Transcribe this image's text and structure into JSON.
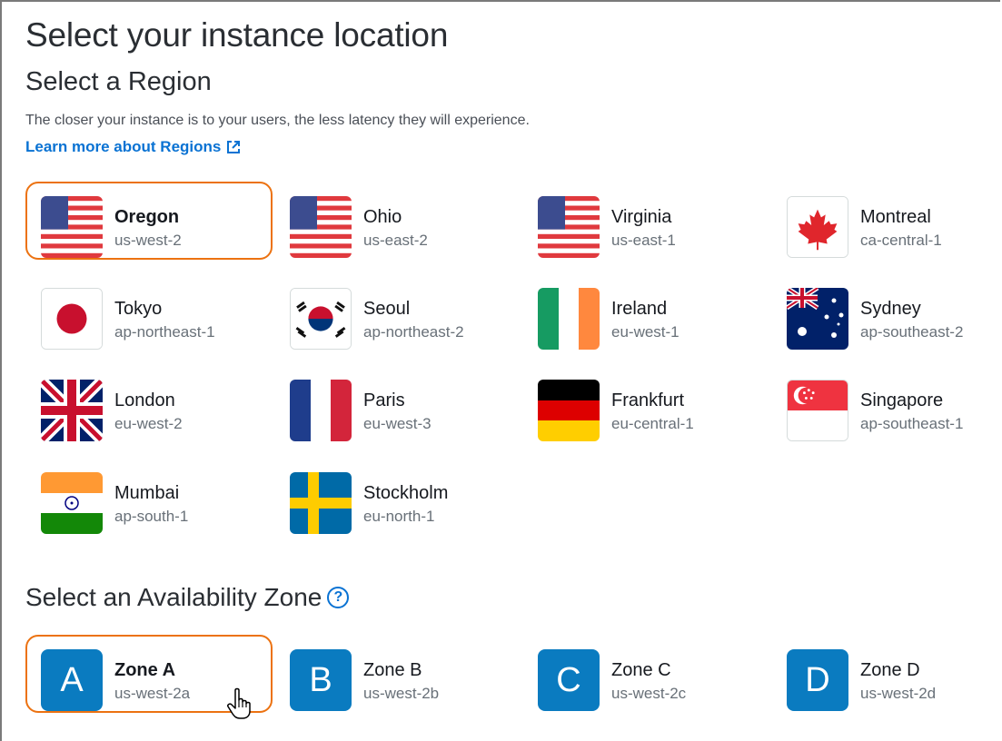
{
  "title": "Select your instance location",
  "region_heading": "Select a Region",
  "region_description": "The closer your instance is to your users, the less latency they will experience.",
  "learn_more": "Learn more about Regions",
  "regions": [
    {
      "name": "Oregon",
      "code": "us-west-2",
      "flag": "us-flag",
      "selected": true
    },
    {
      "name": "Ohio",
      "code": "us-east-2",
      "flag": "us-flag"
    },
    {
      "name": "Virginia",
      "code": "us-east-1",
      "flag": "us-flag"
    },
    {
      "name": "Montreal",
      "code": "ca-central-1",
      "flag": "canada-flag"
    },
    {
      "name": "Tokyo",
      "code": "ap-northeast-1",
      "flag": "japan-flag"
    },
    {
      "name": "Seoul",
      "code": "ap-northeast-2",
      "flag": "korea-flag"
    },
    {
      "name": "Ireland",
      "code": "eu-west-1",
      "flag": "ireland-flag"
    },
    {
      "name": "Sydney",
      "code": "ap-southeast-2",
      "flag": "australia-flag"
    },
    {
      "name": "London",
      "code": "eu-west-2",
      "flag": "uk-flag"
    },
    {
      "name": "Paris",
      "code": "eu-west-3",
      "flag": "france-flag"
    },
    {
      "name": "Frankfurt",
      "code": "eu-central-1",
      "flag": "germany-flag"
    },
    {
      "name": "Singapore",
      "code": "ap-southeast-1",
      "flag": "singapore-flag"
    },
    {
      "name": "Mumbai",
      "code": "ap-south-1",
      "flag": "india-flag"
    },
    {
      "name": "Stockholm",
      "code": "eu-north-1",
      "flag": "sweden-flag"
    }
  ],
  "zone_heading": "Select an Availability Zone",
  "help_icon": "?",
  "zones": [
    {
      "letter": "A",
      "name": "Zone A",
      "code": "us-west-2a",
      "selected": true
    },
    {
      "letter": "B",
      "name": "Zone B",
      "code": "us-west-2b"
    },
    {
      "letter": "C",
      "name": "Zone C",
      "code": "us-west-2c"
    },
    {
      "letter": "D",
      "name": "Zone D",
      "code": "us-west-2d"
    }
  ],
  "colors": {
    "selected_border": "#ec7211",
    "link": "#0972d3",
    "zone_badge": "#0a7bc0"
  }
}
